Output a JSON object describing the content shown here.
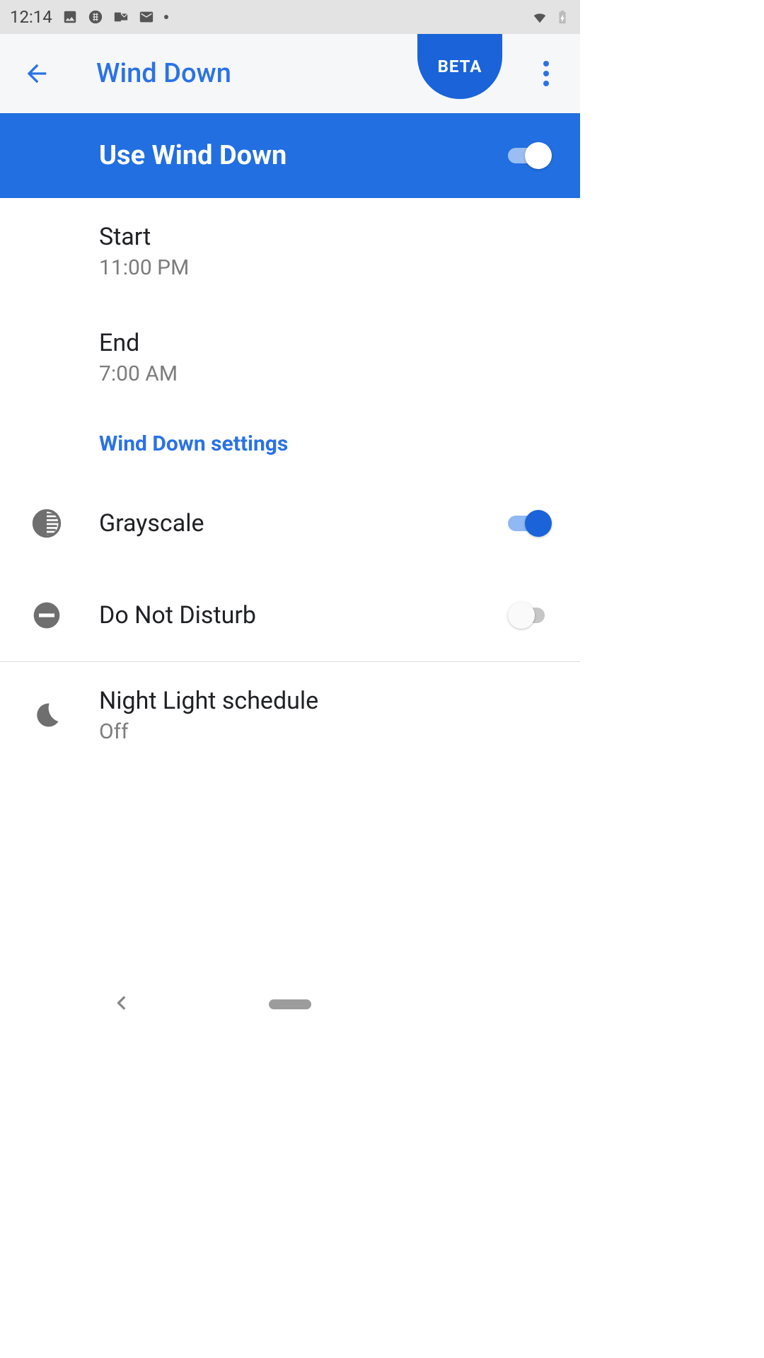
{
  "status_bar": {
    "time": "12:14"
  },
  "app_bar": {
    "title": "Wind Down",
    "beta": "BETA"
  },
  "main_toggle": {
    "label": "Use Wind Down",
    "on": true
  },
  "start": {
    "label": "Start",
    "value": "11:00 PM"
  },
  "end": {
    "label": "End",
    "value": "7:00 AM"
  },
  "section_header": "Wind Down settings",
  "grayscale": {
    "label": "Grayscale",
    "on": true
  },
  "dnd": {
    "label": "Do Not Disturb",
    "on": false
  },
  "night_light": {
    "label": "Night Light schedule",
    "value": "Off"
  }
}
